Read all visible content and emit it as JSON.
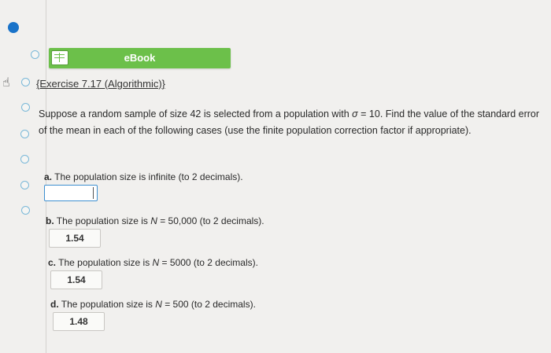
{
  "ebook": {
    "label": "eBook"
  },
  "exercise": {
    "title": "{Exercise 7.17 (Algorithmic)}"
  },
  "question": {
    "text_before_sigma": "Suppose a random sample of size 42 is selected from a population with ",
    "sigma_symbol": "σ",
    "text_after_sigma": " = 10. Find the value of the standard error of the mean in each of the following cases (use the finite population correction factor if appropriate)."
  },
  "parts": [
    {
      "letter": "a.",
      "text": "The population size is infinite (to 2 decimals).",
      "answer": ""
    },
    {
      "letter": "b.",
      "text_pre": "The population size is ",
      "var": "N",
      "text_post": " = 50,000 (to 2 decimals).",
      "answer": "1.54"
    },
    {
      "letter": "c.",
      "text_pre": "The population size is ",
      "var": "N",
      "text_post": " = 5000 (to 2 decimals).",
      "answer": "1.54"
    },
    {
      "letter": "d.",
      "text_pre": "The population size is ",
      "var": "N",
      "text_post": " = 500 (to 2 decimals).",
      "answer": "1.48"
    }
  ],
  "colors": {
    "ebook_green": "#6cc04a",
    "accent_blue": "#1a73c9",
    "input_border": "#3d8fd0"
  }
}
